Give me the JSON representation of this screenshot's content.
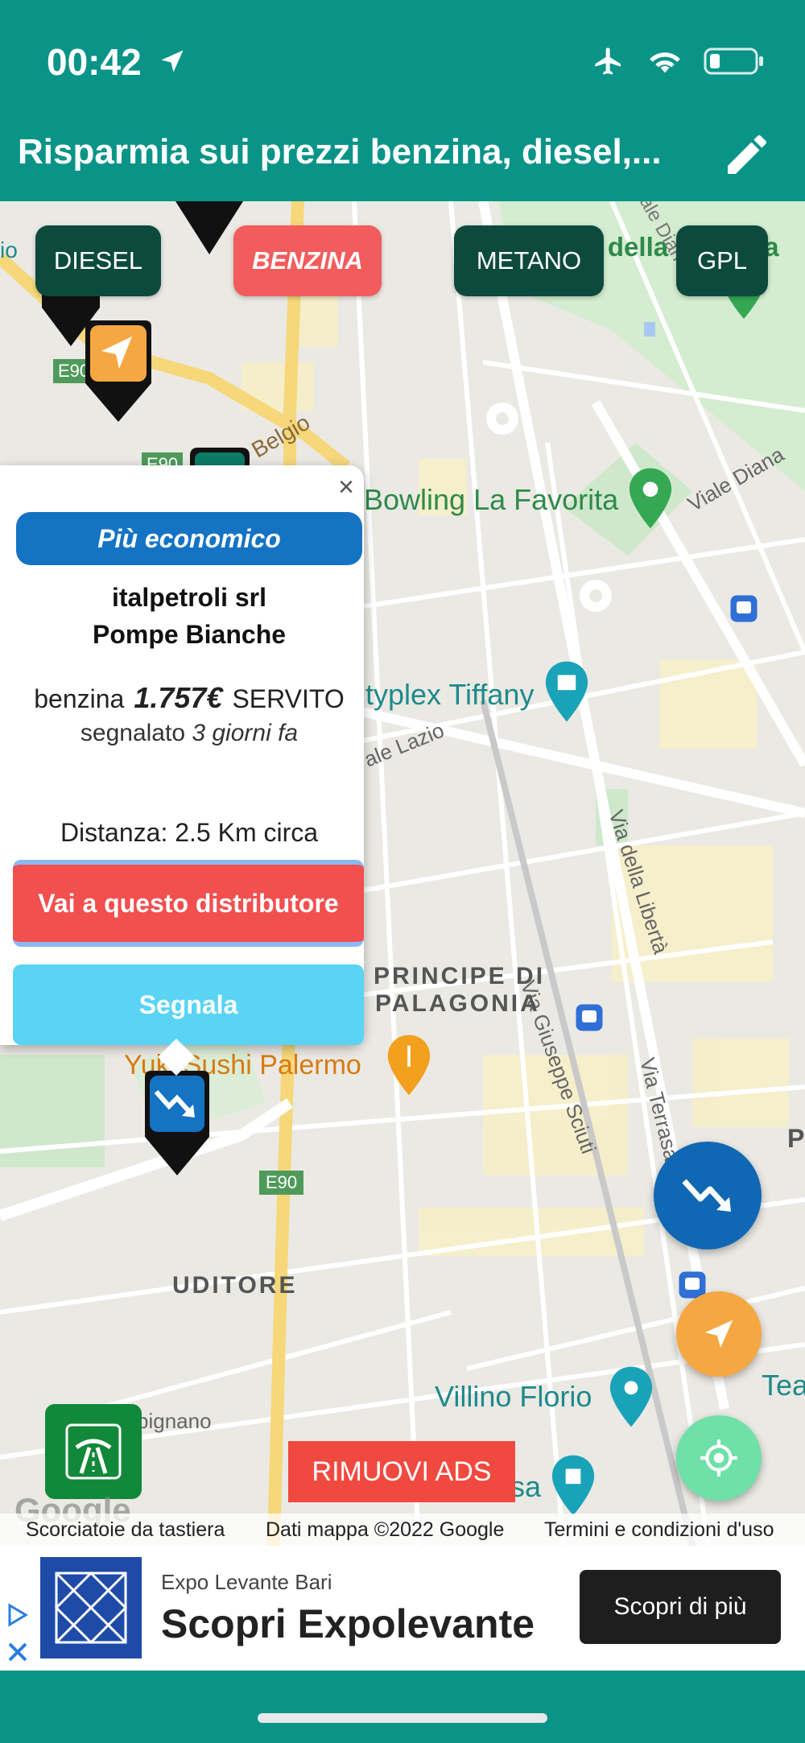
{
  "status_bar": {
    "time": "00:42"
  },
  "header": {
    "title": "Risparmia sui prezzi benzina, diesel,..."
  },
  "fuel_tabs": [
    "DIESEL",
    "BENZINA",
    "METANO",
    "GPL"
  ],
  "active_fuel": "BENZINA",
  "map_labels": {
    "parco": "Parco della Favorita",
    "bowling": "Bowling La Favorita",
    "viale_diana": "Viale Diana",
    "tiffany": "typlex Tiffany",
    "belgio": "Belgio",
    "via_liberta": "Via della Libertà",
    "viale_lazio": "ale Lazio",
    "via_sciuti": "Via Giuseppe Sciuti",
    "principe": "PRINCIPE DI",
    "palagonia": "PALAGONIA",
    "yuki": "Yuki Sushi Palermo",
    "via_terrasanta": "Via Terrasanta",
    "uditore": "UDITORE",
    "villino": "Villino Florio",
    "teatro": "Teatro",
    "e90_a": "E90",
    "e90_b": "E90",
    "e90_c": "E90",
    "p": "P",
    "pignano": "pignano",
    "sa": "sa"
  },
  "popup": {
    "badge": "Più economico",
    "name_line1": "italpetroli srl",
    "name_line2": "Pompe Bianche",
    "fuel": "benzina",
    "price": "1.757€",
    "service": "SERVITO",
    "reported_prefix": "segnalato",
    "reported_when": "3 giorni fa",
    "distance": "Distanza: 2.5 Km circa",
    "go_button": "Vai a questo distributore",
    "report_button": "Segnala",
    "close": "×"
  },
  "remove_ads": "RIMUOVI ADS",
  "google_logo": "Google",
  "map_footer": {
    "shortcuts": "Scorciatoie da tastiera",
    "map_data": "Dati mappa ©2022 Google",
    "terms": "Termini e condizioni d'uso"
  },
  "ad": {
    "sponsor": "Expo Levante Bari",
    "headline": "Scopri Expolevante",
    "cta": "Scopri di più"
  },
  "colors": {
    "header": "#0a9488",
    "active_tab": "#f25c5c",
    "badge": "#1573c4",
    "go_button": "#f24f4f",
    "report_button": "#5ad4f5"
  }
}
